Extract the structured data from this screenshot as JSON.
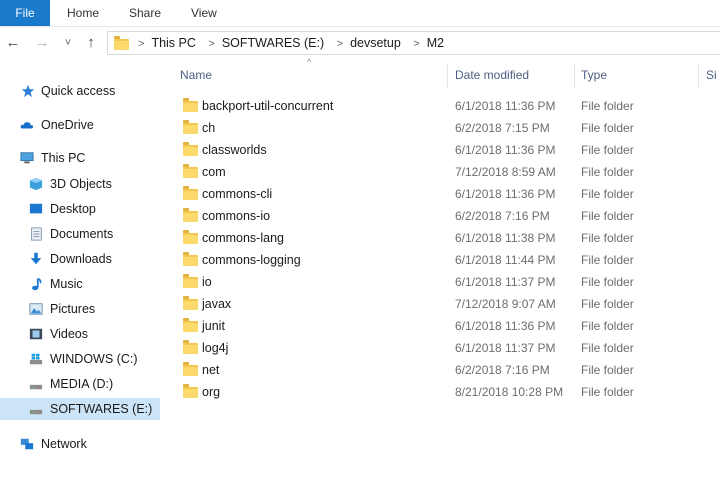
{
  "ribbon": {
    "tabs": [
      "File",
      "Home",
      "Share",
      "View"
    ]
  },
  "nav": {
    "back": "←",
    "forward": "→",
    "recent": "˅",
    "up": "↑",
    "breadcrumb": [
      "This PC",
      "SOFTWARES (E:)",
      "devsetup",
      "M2"
    ]
  },
  "sidebar": {
    "items": [
      {
        "label": "Quick access",
        "icon": "star-icon"
      },
      {
        "label": "OneDrive",
        "icon": "cloud-icon"
      },
      {
        "label": "This PC",
        "icon": "computer-icon"
      },
      {
        "label": "3D Objects",
        "icon": "cube-icon"
      },
      {
        "label": "Desktop",
        "icon": "desktop-icon"
      },
      {
        "label": "Documents",
        "icon": "documents-icon"
      },
      {
        "label": "Downloads",
        "icon": "download-icon"
      },
      {
        "label": "Music",
        "icon": "music-icon"
      },
      {
        "label": "Pictures",
        "icon": "pictures-icon"
      },
      {
        "label": "Videos",
        "icon": "videos-icon"
      },
      {
        "label": "WINDOWS (C:)",
        "icon": "windows-drive-icon"
      },
      {
        "label": "MEDIA (D:)",
        "icon": "drive-icon"
      },
      {
        "label": "SOFTWARES (E:)",
        "icon": "drive-icon",
        "selected": true
      },
      {
        "label": "Network",
        "icon": "network-icon"
      }
    ]
  },
  "columns": {
    "name": "Name",
    "date": "Date modified",
    "type": "Type",
    "size": "Si",
    "sort_indicator": "^"
  },
  "files": [
    {
      "name": "backport-util-concurrent",
      "date": "6/1/2018 11:36 PM",
      "type": "File folder"
    },
    {
      "name": "ch",
      "date": "6/2/2018 7:15 PM",
      "type": "File folder"
    },
    {
      "name": "classworlds",
      "date": "6/1/2018 11:36 PM",
      "type": "File folder"
    },
    {
      "name": "com",
      "date": "7/12/2018 8:59 AM",
      "type": "File folder"
    },
    {
      "name": "commons-cli",
      "date": "6/1/2018 11:36 PM",
      "type": "File folder"
    },
    {
      "name": "commons-io",
      "date": "6/2/2018 7:16 PM",
      "type": "File folder"
    },
    {
      "name": "commons-lang",
      "date": "6/1/2018 11:38 PM",
      "type": "File folder"
    },
    {
      "name": "commons-logging",
      "date": "6/1/2018 11:44 PM",
      "type": "File folder"
    },
    {
      "name": "io",
      "date": "6/1/2018 11:37 PM",
      "type": "File folder"
    },
    {
      "name": "javax",
      "date": "7/12/2018 9:07 AM",
      "type": "File folder"
    },
    {
      "name": "junit",
      "date": "6/1/2018 11:36 PM",
      "type": "File folder"
    },
    {
      "name": "log4j",
      "date": "6/1/2018 11:37 PM",
      "type": "File folder"
    },
    {
      "name": "net",
      "date": "6/2/2018 7:16 PM",
      "type": "File folder"
    },
    {
      "name": "org",
      "date": "8/21/2018 10:28 PM",
      "type": "File folder"
    }
  ]
}
